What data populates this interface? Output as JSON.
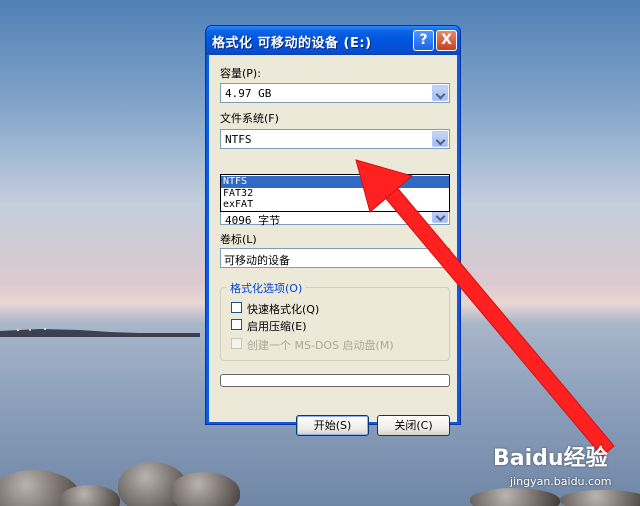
{
  "window": {
    "title": "格式化 可移动的设备 (E:)",
    "help_label": "?",
    "close_label": "X"
  },
  "capacity": {
    "label": "容量(P):",
    "value": "4.97 GB"
  },
  "filesystem": {
    "label": "文件系统(F)",
    "value": "NTFS",
    "options": [
      "NTFS",
      "FAT32",
      "exFAT"
    ],
    "selected_index": 0
  },
  "allocation": {
    "partial_value": "4096 字节"
  },
  "volume_label": {
    "label": "卷标(L)",
    "value": "可移动的设备"
  },
  "format_options": {
    "title": "格式化选项(O)",
    "quick_format": "快速格式化(Q)",
    "compression": "启用压缩(E)",
    "msdos_boot": "创建一个 MS-DOS 启动盘(M)"
  },
  "progress": {
    "fraction": 0
  },
  "buttons": {
    "start": "开始(S)",
    "close": "关闭(C)"
  },
  "watermark": {
    "brand": "Baidu经验",
    "url": "jingyan.baidu.com"
  },
  "colors": {
    "accent": "#0a5ce0",
    "selection": "#316ac5",
    "annotation": "#ff2020"
  }
}
